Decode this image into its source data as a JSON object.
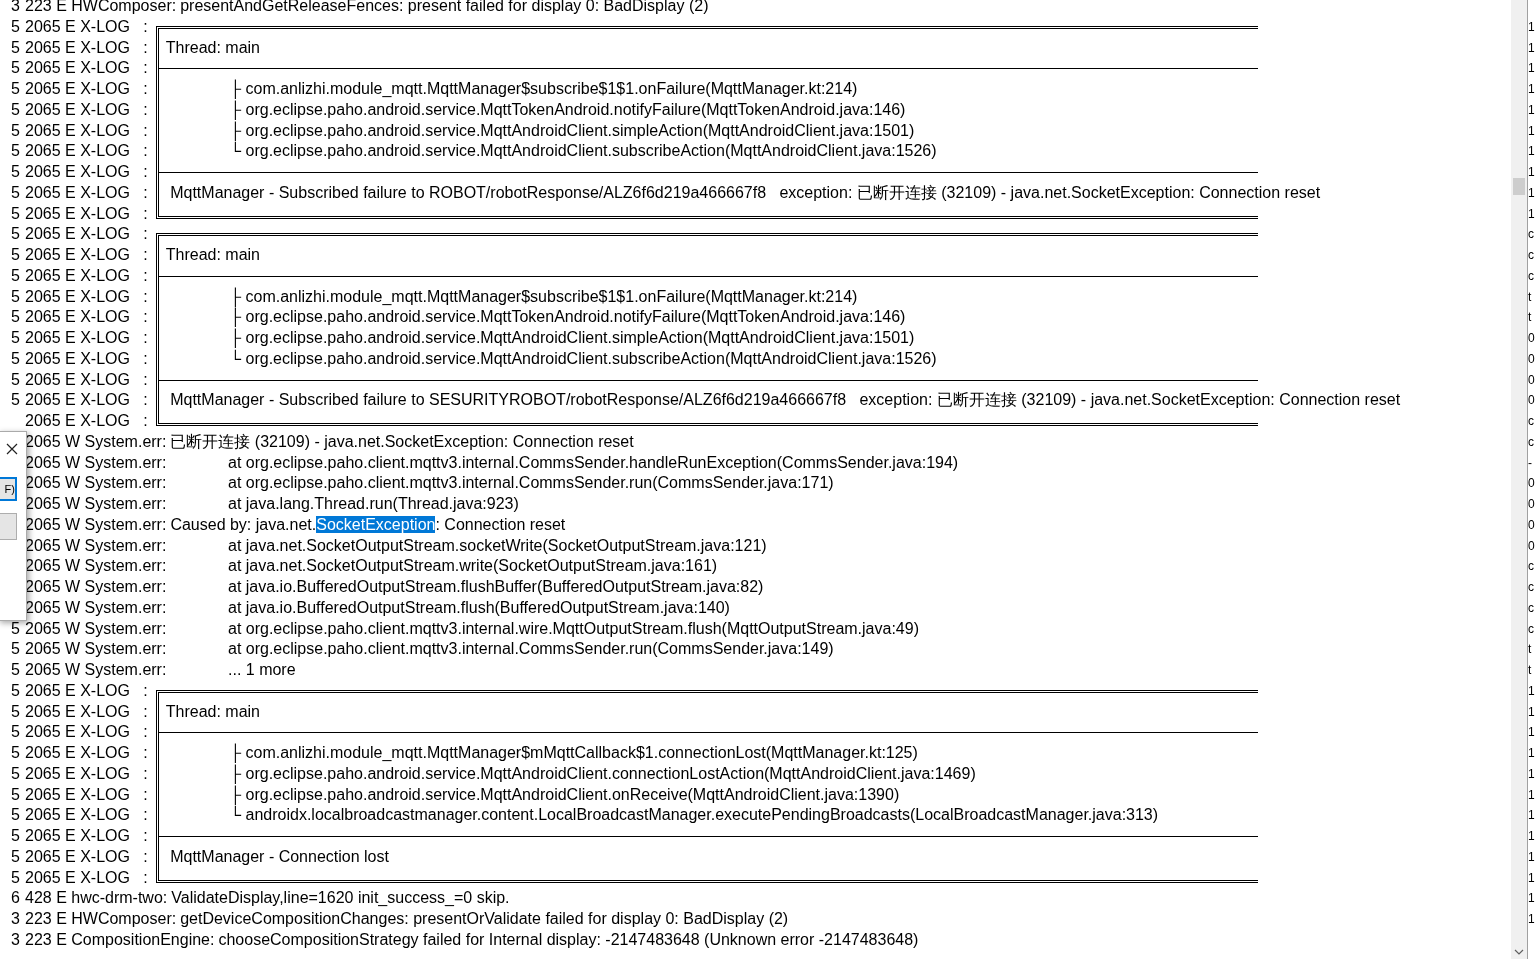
{
  "log": {
    "lines": [
      {
        "prefix": "3",
        "head": "223 E HWComposer:",
        "kind": "plain",
        "message": "presentAndGetReleaseFences: present failed for display 0: BadDisplay (2)"
      },
      {
        "prefix": "5",
        "head": "2065 E X-LOG   :",
        "kind": "top",
        "edge": "1"
      },
      {
        "prefix": "5",
        "head": "2065 E X-LOG   :",
        "kind": "boxed",
        "message": "Thread: main",
        "edge": "1"
      },
      {
        "prefix": "5",
        "head": "2065 E X-LOG   :",
        "kind": "divider",
        "edge": "1"
      },
      {
        "prefix": "5",
        "head": "2065 E X-LOG   :",
        "kind": "frame",
        "message": "├ com.anlizhi.module_mqtt.MqttManager$subscribe$1$1.onFailure(MqttManager.kt:214)",
        "edge": "1"
      },
      {
        "prefix": "5",
        "head": "2065 E X-LOG   :",
        "kind": "frame",
        "message": "├ org.eclipse.paho.android.service.MqttTokenAndroid.notifyFailure(MqttTokenAndroid.java:146)",
        "edge": "1"
      },
      {
        "prefix": "5",
        "head": "2065 E X-LOG   :",
        "kind": "frame",
        "message": "├ org.eclipse.paho.android.service.MqttAndroidClient.simpleAction(MqttAndroidClient.java:1501)",
        "edge": "1"
      },
      {
        "prefix": "5",
        "head": "2065 E X-LOG   :",
        "kind": "frame",
        "message": "└ org.eclipse.paho.android.service.MqttAndroidClient.subscribeAction(MqttAndroidClient.java:1526)",
        "edge": "1"
      },
      {
        "prefix": "5",
        "head": "2065 E X-LOG   :",
        "kind": "divider",
        "edge": "1"
      },
      {
        "prefix": "5",
        "head": "2065 E X-LOG   :",
        "kind": "boxed",
        "message": " MqttManager - Subscribed failure to ROBOT/robotResponse/ALZ6f6d219a466667f8   exception: 已断开连接 (32109) - java.net.SocketException: Connection reset",
        "edge": "1"
      },
      {
        "prefix": "5",
        "head": "2065 E X-LOG   :",
        "kind": "bottom",
        "edge": "1"
      },
      {
        "prefix": "5",
        "head": "2065 E X-LOG   :",
        "kind": "top",
        "edge": "c"
      },
      {
        "prefix": "5",
        "head": "2065 E X-LOG   :",
        "kind": "boxed",
        "message": "Thread: main",
        "edge": "c"
      },
      {
        "prefix": "5",
        "head": "2065 E X-LOG   :",
        "kind": "divider",
        "edge": "c"
      },
      {
        "prefix": "5",
        "head": "2065 E X-LOG   :",
        "kind": "frame",
        "message": "├ com.anlizhi.module_mqtt.MqttManager$subscribe$1$1.onFailure(MqttManager.kt:214)",
        "edge": "t"
      },
      {
        "prefix": "5",
        "head": "2065 E X-LOG   :",
        "kind": "frame",
        "message": "├ org.eclipse.paho.android.service.MqttTokenAndroid.notifyFailure(MqttTokenAndroid.java:146)",
        "edge": "t"
      },
      {
        "prefix": "5",
        "head": "2065 E X-LOG   :",
        "kind": "frame",
        "message": "├ org.eclipse.paho.android.service.MqttAndroidClient.simpleAction(MqttAndroidClient.java:1501)",
        "edge": "0"
      },
      {
        "prefix": "5",
        "head": "2065 E X-LOG   :",
        "kind": "frame",
        "message": "└ org.eclipse.paho.android.service.MqttAndroidClient.subscribeAction(MqttAndroidClient.java:1526)",
        "edge": "0"
      },
      {
        "prefix": "5",
        "head": "2065 E X-LOG   :",
        "kind": "divider",
        "edge": "0"
      },
      {
        "prefix": "5",
        "head": "2065 E X-LOG   :",
        "kind": "boxed",
        "message": " MqttManager - Subscribed failure to SESURITYROBOT/robotResponse/ALZ6f6d219a466667f8   exception: 已断开连接 (32109) - java.net.SocketException: Connection reset",
        "edge": "0"
      },
      {
        "head": "2065 E X-LOG   :",
        "kind": "bottom",
        "edge": "c"
      },
      {
        "head": "2065 W System.err:",
        "kind": "plain",
        "message": "已断开连接 (32109) - java.net.SocketException: Connection reset",
        "edge": "c"
      },
      {
        "head": "2065 W System.err:",
        "kind": "at",
        "message": "at org.eclipse.paho.client.mqttv3.internal.CommsSender.handleRunException(CommsSender.java:194)",
        "edge": "-"
      },
      {
        "head": "2065 W System.err:",
        "kind": "at",
        "message": "at org.eclipse.paho.client.mqttv3.internal.CommsSender.run(CommsSender.java:171)",
        "edge": "0"
      },
      {
        "head": "2065 W System.err:",
        "kind": "at",
        "message": "at java.lang.Thread.run(Thread.java:923)",
        "edge": "0"
      },
      {
        "head": "2065 W System.err:",
        "kind": "plain",
        "segments": [
          {
            "text": "Caused by: java.net.",
            "selected": false
          },
          {
            "text": "SocketException",
            "selected": true
          },
          {
            "text": ": Connection reset",
            "selected": false
          }
        ],
        "edge": "0"
      },
      {
        "head": "2065 W System.err:",
        "kind": "at",
        "message": "at java.net.SocketOutputStream.socketWrite(SocketOutputStream.java:121)",
        "edge": "0"
      },
      {
        "head": "2065 W System.err:",
        "kind": "at",
        "message": "at java.net.SocketOutputStream.write(SocketOutputStream.java:161)",
        "edge": "c"
      },
      {
        "head": "2065 W System.err:",
        "kind": "at",
        "message": "at java.io.BufferedOutputStream.flushBuffer(BufferedOutputStream.java:82)",
        "edge": "c"
      },
      {
        "head": "2065 W System.err:",
        "kind": "at",
        "message": "at java.io.BufferedOutputStream.flush(BufferedOutputStream.java:140)",
        "edge": "c"
      },
      {
        "prefix": "5",
        "head": "2065 W System.err:",
        "kind": "at",
        "message": "at org.eclipse.paho.client.mqttv3.internal.wire.MqttOutputStream.flush(MqttOutputStream.java:49)",
        "edge": "c"
      },
      {
        "prefix": "5",
        "head": "2065 W System.err:",
        "kind": "at",
        "message": "at org.eclipse.paho.client.mqttv3.internal.CommsSender.run(CommsSender.java:149)",
        "edge": "t"
      },
      {
        "prefix": "5",
        "head": "2065 W System.err:",
        "kind": "at",
        "message": "... 1 more",
        "edge": "t"
      },
      {
        "prefix": "5",
        "head": "2065 E X-LOG   :",
        "kind": "top",
        "edge": "1"
      },
      {
        "prefix": "5",
        "head": "2065 E X-LOG   :",
        "kind": "boxed",
        "message": "Thread: main",
        "edge": "1"
      },
      {
        "prefix": "5",
        "head": "2065 E X-LOG   :",
        "kind": "divider",
        "edge": "1"
      },
      {
        "prefix": "5",
        "head": "2065 E X-LOG   :",
        "kind": "frame",
        "message": "├ com.anlizhi.module_mqtt.MqttManager$mMqttCallback$1.connectionLost(MqttManager.kt:125)",
        "edge": "1"
      },
      {
        "prefix": "5",
        "head": "2065 E X-LOG   :",
        "kind": "frame",
        "message": "├ org.eclipse.paho.android.service.MqttAndroidClient.connectionLostAction(MqttAndroidClient.java:1469)",
        "edge": "1"
      },
      {
        "prefix": "5",
        "head": "2065 E X-LOG   :",
        "kind": "frame",
        "message": "├ org.eclipse.paho.android.service.MqttAndroidClient.onReceive(MqttAndroidClient.java:1390)",
        "edge": "1"
      },
      {
        "prefix": "5",
        "head": "2065 E X-LOG   :",
        "kind": "frame",
        "message": "└ androidx.localbroadcastmanager.content.LocalBroadcastManager.executePendingBroadcasts(LocalBroadcastManager.java:313)",
        "edge": "1"
      },
      {
        "prefix": "5",
        "head": "2065 E X-LOG   :",
        "kind": "divider",
        "edge": "1"
      },
      {
        "prefix": "5",
        "head": "2065 E X-LOG   :",
        "kind": "boxed",
        "message": " MqttManager - Connection lost",
        "edge": "1"
      },
      {
        "prefix": "5",
        "head": "2065 E X-LOG   :",
        "kind": "bottom",
        "edge": "1"
      },
      {
        "prefix": "6",
        "head": "428 E hwc-drm-two:",
        "kind": "plain",
        "message": "ValidateDisplay,line=1620 init_success_=0 skip.",
        "edge": "1"
      },
      {
        "prefix": "3",
        "head": "223 E HWComposer:",
        "kind": "plain",
        "message": "getDeviceCompositionChanges: presentOrValidate failed for display 0: BadDisplay (2)",
        "edge": "1"
      },
      {
        "prefix": "3",
        "head": "223 E CompositionEngine:",
        "kind": "plain",
        "message": "chooseCompositionStrategy failed for Internal display: -2147483648 (Unknown error -2147483648)"
      }
    ]
  },
  "dialog": {
    "button": "F)"
  }
}
